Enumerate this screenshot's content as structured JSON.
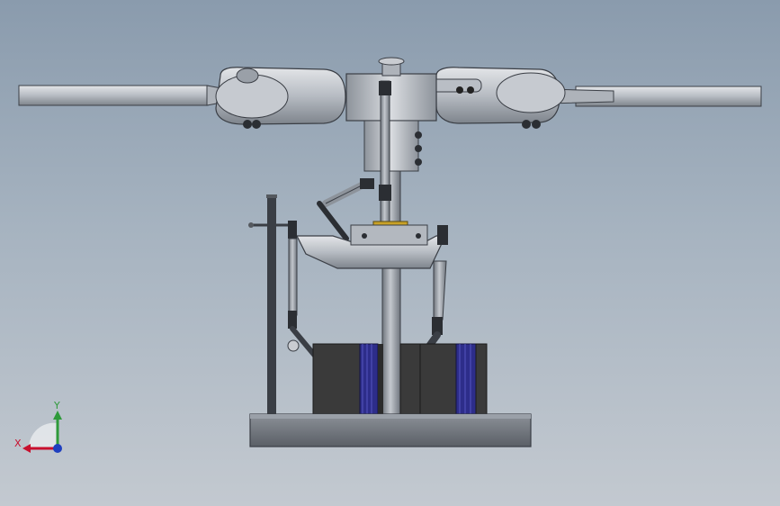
{
  "viewport": {
    "background_top": "#8a9bad",
    "background_bottom": "#c3c9d0"
  },
  "model": {
    "subject": "helicopter-rotor-head-assembly",
    "colors": {
      "metal_light": "#c9ccd1",
      "metal_mid": "#9aa0a8",
      "metal_dark": "#5b6068",
      "servo_body": "#3a3a3a",
      "servo_coil": "#2d2d8a",
      "brass": "#c9a227",
      "base_plate": "#6f747b"
    }
  },
  "triad": {
    "x_label": "X",
    "y_label": "Y",
    "x_color": "#c8102e",
    "y_color": "#2e9a3a",
    "z_color": "#1f3fbf"
  }
}
